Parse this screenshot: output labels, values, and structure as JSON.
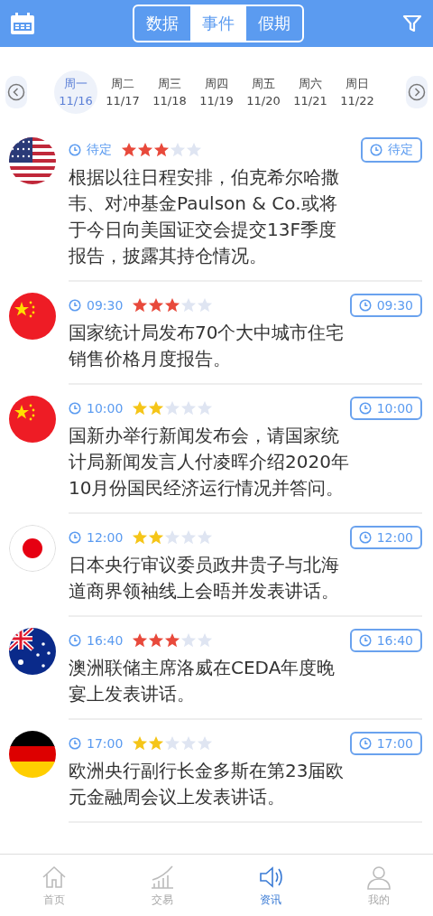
{
  "header": {
    "tabs": [
      {
        "label": "数据",
        "selected": false
      },
      {
        "label": "事件",
        "selected": true
      },
      {
        "label": "假期",
        "selected": false
      }
    ]
  },
  "week": {
    "days": [
      {
        "weekday": "周一",
        "date": "11/16",
        "selected": true
      },
      {
        "weekday": "周二",
        "date": "11/17",
        "selected": false
      },
      {
        "weekday": "周三",
        "date": "11/18",
        "selected": false
      },
      {
        "weekday": "周四",
        "date": "11/19",
        "selected": false
      },
      {
        "weekday": "周五",
        "date": "11/20",
        "selected": false
      },
      {
        "weekday": "周六",
        "date": "11/21",
        "selected": false
      },
      {
        "weekday": "周日",
        "date": "11/22",
        "selected": false
      }
    ]
  },
  "events": [
    {
      "kind": "us",
      "time": "待定",
      "stars": 3,
      "badge": "待定",
      "text": "根据以往日程安排，伯克希尔哈撒韦、对冲基金Paulson & Co.或将于今日向美国证交会提交13F季度报告，披露其持仓情况。"
    },
    {
      "kind": "cn",
      "time": "09:30",
      "stars": 3,
      "badge": "09:30",
      "text": "国家统计局发布70个大中城市住宅销售价格月度报告。"
    },
    {
      "kind": "cn",
      "time": "10:00",
      "stars": 2,
      "badge": "10:00",
      "text": "国新办举行新闻发布会，请国家统计局新闻发言人付凌晖介绍2020年10月份国民经济运行情况并答问。"
    },
    {
      "kind": "jp",
      "time": "12:00",
      "stars": 2,
      "badge": "12:00",
      "text": "日本央行审议委员政井贵子与北海道商界领袖线上会晤并发表讲话。"
    },
    {
      "kind": "au",
      "time": "16:40",
      "stars": 3,
      "badge": "16:40",
      "text": "澳洲联储主席洛威在CEDA年度晚宴上发表讲话。"
    },
    {
      "kind": "de",
      "time": "17:00",
      "stars": 2,
      "badge": "17:00",
      "text": "欧洲央行副行长金多斯在第23届欧元金融周会议上发表讲话。"
    }
  ],
  "tabbar": [
    {
      "label": "首页",
      "selected": false
    },
    {
      "label": "交易",
      "selected": false
    },
    {
      "label": "资讯",
      "selected": true
    },
    {
      "label": "我的",
      "selected": false
    }
  ]
}
